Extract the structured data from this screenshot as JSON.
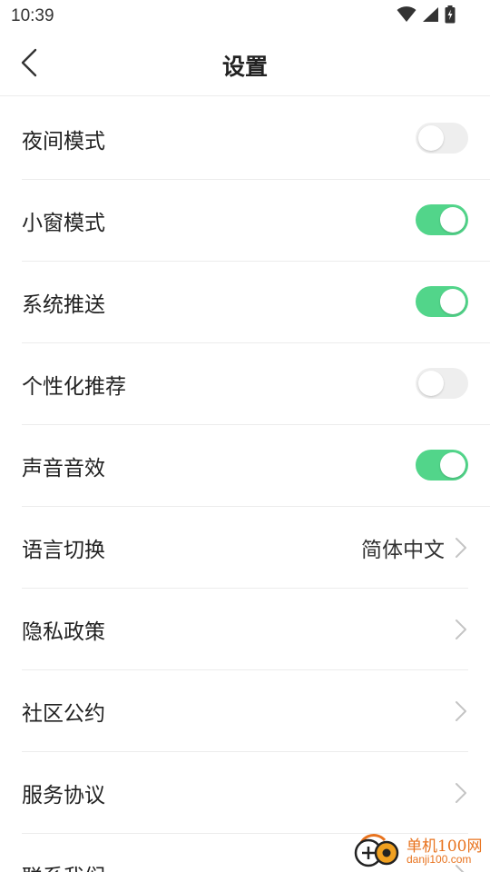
{
  "status_bar": {
    "time": "10:39"
  },
  "header": {
    "title": "设置"
  },
  "settings": {
    "night_mode": {
      "label": "夜间模式",
      "enabled": false
    },
    "floating_window": {
      "label": "小窗模式",
      "enabled": true
    },
    "system_push": {
      "label": "系统推送",
      "enabled": true
    },
    "personalized": {
      "label": "个性化推荐",
      "enabled": false
    },
    "sound_effects": {
      "label": "声音音效",
      "enabled": true
    },
    "language": {
      "label": "语言切换",
      "value": "简体中文"
    },
    "privacy": {
      "label": "隐私政策"
    },
    "community": {
      "label": "社区公约"
    },
    "service": {
      "label": "服务协议"
    },
    "contact": {
      "label": "联系我们"
    }
  },
  "watermark": {
    "name": "单机100网",
    "url": "danji100.com"
  },
  "colors": {
    "toggle_on": "#52d58a",
    "toggle_off": "#eeeeee",
    "watermark": "#e8731e"
  }
}
